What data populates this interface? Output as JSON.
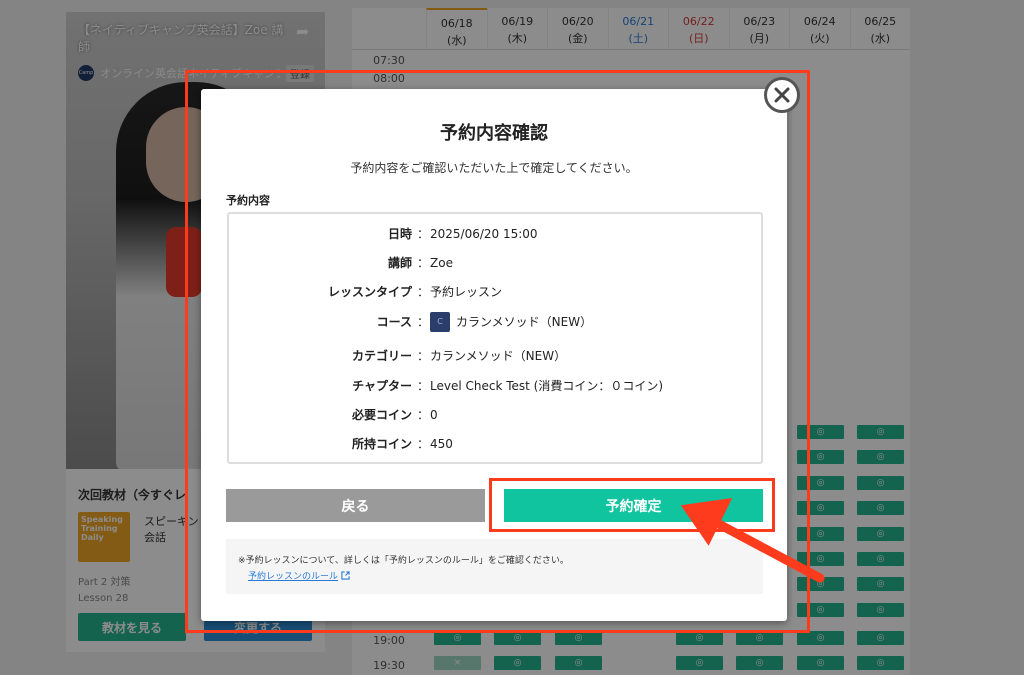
{
  "video": {
    "title": "【ネイティブキャンプ英会話】Zoe 講師",
    "channel_name": "オンライン英会話ネイティブキャンプ",
    "channel_logo_text": "Camp",
    "subscribe_label": "登録"
  },
  "next_material": {
    "label": "次回教材（今すぐレ",
    "thumb_text": "Speaking Training Daily",
    "name_line1": "スピーキン",
    "name_line2": "会話",
    "part": "Part 2 対策",
    "lesson": "Lesson 28",
    "view_button": "教材を見る",
    "second_button": "変更する"
  },
  "schedule": {
    "dates": [
      {
        "date": "06/18",
        "day": "(水)",
        "color": "normal"
      },
      {
        "date": "06/19",
        "day": "(木)",
        "color": "normal"
      },
      {
        "date": "06/20",
        "day": "(金)",
        "color": "normal"
      },
      {
        "date": "06/21",
        "day": "(土)",
        "color": "blue"
      },
      {
        "date": "06/22",
        "day": "(日)",
        "color": "red"
      },
      {
        "date": "06/23",
        "day": "(月)",
        "color": "normal"
      },
      {
        "date": "06/24",
        "day": "(火)",
        "color": "normal"
      },
      {
        "date": "06/25",
        "day": "(水)",
        "color": "normal"
      }
    ],
    "times": [
      "07:30",
      "08:00",
      "19:00",
      "19:30"
    ],
    "slot_symbol": "◎",
    "slot_unavailable": "×"
  },
  "modal": {
    "title": "予約内容確認",
    "subtitle": "予約内容をご確認いただいた上で確定してください。",
    "section_label": "予約内容",
    "rows": [
      {
        "label": "日時",
        "value": "2025/06/20 15:00"
      },
      {
        "label": "講師",
        "value": "Zoe"
      },
      {
        "label": "レッスンタイプ",
        "value": "予約レッスン"
      },
      {
        "label": "コース",
        "value": "カランメソッド（NEW）"
      },
      {
        "label": "カテゴリー",
        "value": "カランメソッド（NEW）"
      },
      {
        "label": "チャプター",
        "value": "Level Check Test (消費コイン：０コイン)"
      },
      {
        "label": "必要コイン",
        "value": "0"
      },
      {
        "label": "所持コイン",
        "value": "450"
      }
    ],
    "colon": "：",
    "course_icon_text": "C",
    "back_button": "戻る",
    "confirm_button": "予約確定",
    "note": "※予約レッスンについて、詳しくは「予約レッスンのルール」をご確認ください。",
    "note_link": "予約レッスンのルール"
  },
  "colors": {
    "accent_green": "#10c4a0",
    "highlight_red": "#ff3b1e",
    "back_gray": "#9a9a9a"
  }
}
